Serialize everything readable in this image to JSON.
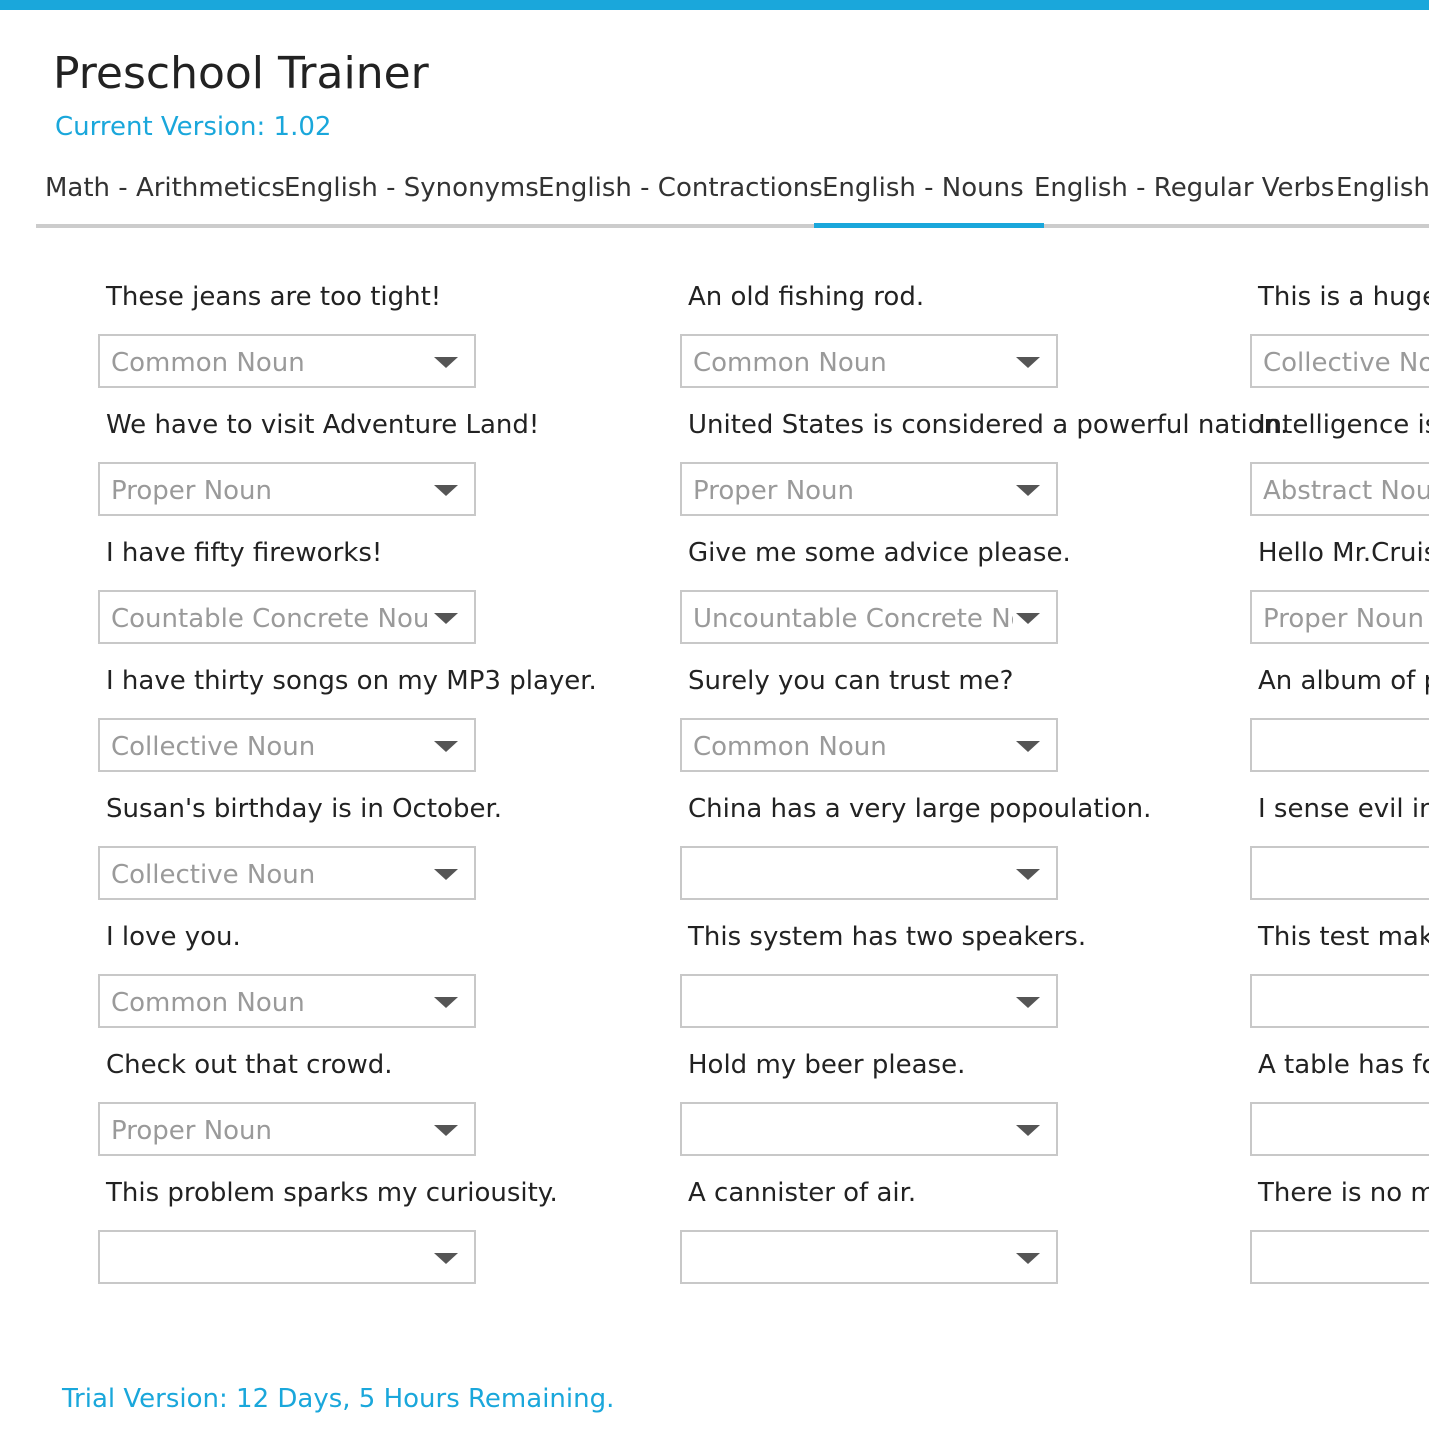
{
  "app": {
    "title": "Preschool Trainer",
    "version_label": "Current Version: 1.02",
    "trial_label": "Trial Version: 12 Days, 5 Hours Remaining."
  },
  "colors": {
    "accent": "#1aa7db",
    "border": "#c8c8c8",
    "placeholder_text": "#9a9a9a"
  },
  "tabs": [
    {
      "label": "Math - Arithmetics",
      "active": false
    },
    {
      "label": "English - Synonyms",
      "active": false
    },
    {
      "label": "English - Contractions",
      "active": false
    },
    {
      "label": "English - Nouns",
      "active": true
    },
    {
      "label": "English - Regular Verbs",
      "active": false
    },
    {
      "label": "English -",
      "active": false
    }
  ],
  "columns": [
    {
      "items": [
        {
          "sentence": "These jeans are too tight!",
          "answer": "Common Noun"
        },
        {
          "sentence": "We have to visit Adventure Land!",
          "answer": "Proper Noun"
        },
        {
          "sentence": "I have fifty fireworks!",
          "answer": "Countable Concrete Noun"
        },
        {
          "sentence": "I have thirty songs on my MP3 player.",
          "answer": "Collective Noun"
        },
        {
          "sentence": "Susan's birthday is in October.",
          "answer": "Collective Noun"
        },
        {
          "sentence": "I love you.",
          "answer": "Common Noun"
        },
        {
          "sentence": "Check out that crowd.",
          "answer": "Proper Noun"
        },
        {
          "sentence": "This problem sparks my curiousity.",
          "answer": ""
        }
      ]
    },
    {
      "items": [
        {
          "sentence": "An old fishing rod.",
          "answer": "Common Noun"
        },
        {
          "sentence": "United States is considered a powerful nation.",
          "answer": "Proper Noun"
        },
        {
          "sentence": "Give me some advice please.",
          "answer": "Uncountable Concrete Noun"
        },
        {
          "sentence": "Surely you can trust me?",
          "answer": "Common Noun"
        },
        {
          "sentence": "China has a very large popoulation.",
          "answer": ""
        },
        {
          "sentence": "This system has two speakers.",
          "answer": ""
        },
        {
          "sentence": "Hold my beer please.",
          "answer": ""
        },
        {
          "sentence": "A cannister of air.",
          "answer": ""
        }
      ]
    },
    {
      "items": [
        {
          "sentence": "This is a huge a",
          "answer": "Collective Nou"
        },
        {
          "sentence": "Intelligence is r",
          "answer": "Abstract Noun"
        },
        {
          "sentence": "Hello Mr.Cruise",
          "answer": "Proper Noun"
        },
        {
          "sentence": "An album of p",
          "answer": ""
        },
        {
          "sentence": "I sense evil in th",
          "answer": ""
        },
        {
          "sentence": "This test makes",
          "answer": ""
        },
        {
          "sentence": "A table has fou",
          "answer": ""
        },
        {
          "sentence": "There is no mo",
          "answer": ""
        }
      ]
    }
  ]
}
